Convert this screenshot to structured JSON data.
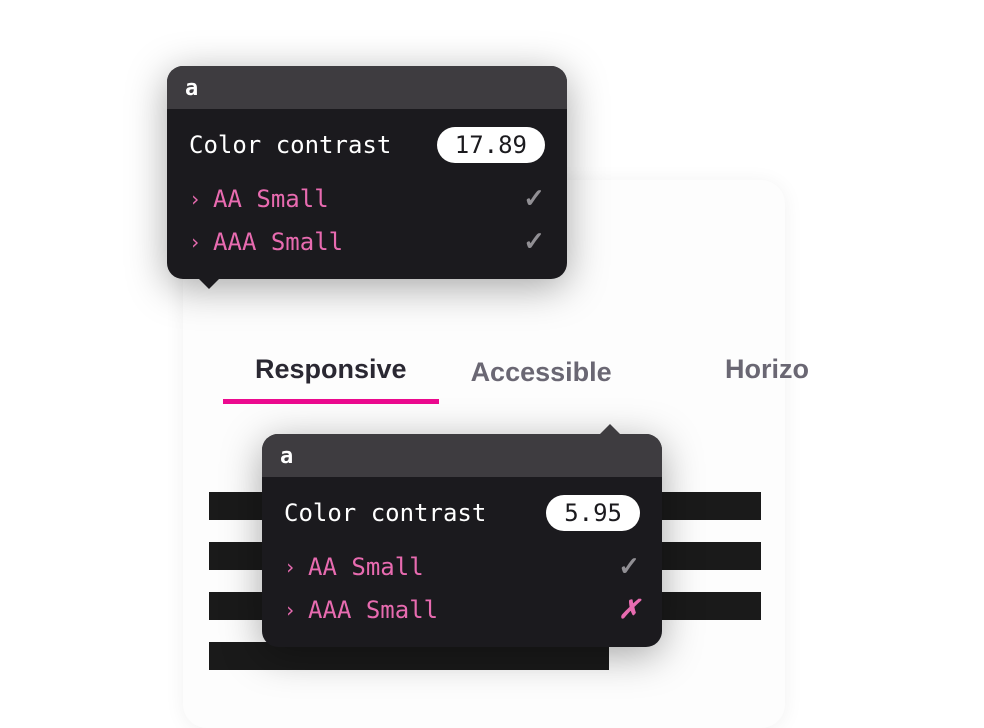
{
  "tabs": {
    "responsive": "Responsive",
    "accessible": "Accessible",
    "horizontal": "Horizo"
  },
  "tooltip1": {
    "header": "a",
    "contrast_label": "Color contrast",
    "contrast_value": "17.89",
    "criteria": [
      {
        "label": "AA Small",
        "status": "pass"
      },
      {
        "label": "AAA Small",
        "status": "pass"
      }
    ]
  },
  "tooltip2": {
    "header": "a",
    "contrast_label": "Color contrast",
    "contrast_value": "5.95",
    "criteria": [
      {
        "label": "AA Small",
        "status": "pass"
      },
      {
        "label": "AAA Small",
        "status": "fail"
      }
    ]
  },
  "colors": {
    "accent": "#ec0a8f",
    "tooltip_bg": "#1b1a1e",
    "tooltip_header": "#3e3c40",
    "criteria_text": "#e86bb0"
  }
}
